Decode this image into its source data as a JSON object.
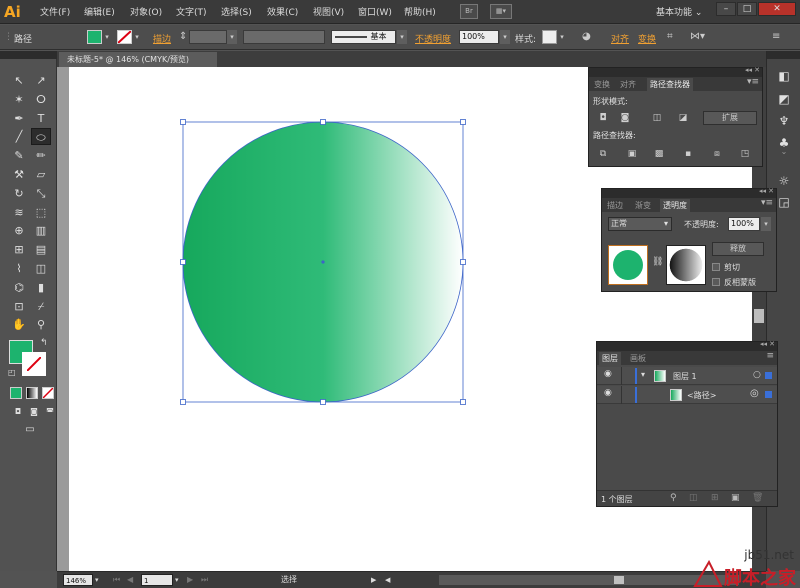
{
  "app": {
    "logo": "Ai"
  },
  "menubar": {
    "items": [
      "文件(F)",
      "编辑(E)",
      "对象(O)",
      "文字(T)",
      "选择(S)",
      "效果(C)",
      "视图(V)",
      "窗口(W)",
      "帮助(H)"
    ],
    "bridge_label": "Br",
    "workspace": "基本功能 ⌄",
    "win_minimize": "–",
    "win_restore": "□",
    "win_close": "✕"
  },
  "controlbar": {
    "object_type": "路径",
    "stroke_link": "描边",
    "stroke_style_label": "基本",
    "opacity_link": "不透明度",
    "opacity_value": "100%",
    "style_label": "样式:",
    "align_link": "对齐",
    "transform_link": "变换",
    "fill_color": "#1db36e"
  },
  "document": {
    "tab_title": "未标题-5* @ 146% (CMYK/预览)"
  },
  "canvas": {
    "gradient_start": "#16a85c",
    "gradient_mid": "#2fbb78",
    "gradient_end": "#ffffff",
    "bbox_color": "#3c64c8"
  },
  "toolbar": {
    "fill_swatch": "#1db36e",
    "tools": [
      {
        "name": "selection-tool",
        "glyph": "↖"
      },
      {
        "name": "direct-selection-tool",
        "glyph": "↗"
      },
      {
        "name": "magic-wand-tool",
        "glyph": "✶"
      },
      {
        "name": "lasso-tool",
        "glyph": "ⵔ"
      },
      {
        "name": "pen-tool",
        "glyph": "✒"
      },
      {
        "name": "type-tool",
        "glyph": "T"
      },
      {
        "name": "line-tool",
        "glyph": "╱"
      },
      {
        "name": "ellipse-tool",
        "glyph": "⬭"
      },
      {
        "name": "paintbrush-tool",
        "glyph": "✎"
      },
      {
        "name": "pencil-tool",
        "glyph": "✏"
      },
      {
        "name": "blob-brush-tool",
        "glyph": "⚒"
      },
      {
        "name": "eraser-tool",
        "glyph": "▱"
      },
      {
        "name": "rotate-tool",
        "glyph": "↻"
      },
      {
        "name": "scale-tool",
        "glyph": "⤡"
      },
      {
        "name": "warp-tool",
        "glyph": "≋"
      },
      {
        "name": "free-transform-tool",
        "glyph": "⬚"
      },
      {
        "name": "shape-builder-tool",
        "glyph": "⊕"
      },
      {
        "name": "perspective-grid-tool",
        "glyph": "▥"
      },
      {
        "name": "mesh-tool",
        "glyph": "⊞"
      },
      {
        "name": "gradient-tool",
        "glyph": "▤"
      },
      {
        "name": "eyedropper-tool",
        "glyph": "⌇"
      },
      {
        "name": "blend-tool",
        "glyph": "◫"
      },
      {
        "name": "symbol-sprayer-tool",
        "glyph": "⌬"
      },
      {
        "name": "column-graph-tool",
        "glyph": "▮"
      },
      {
        "name": "artboard-tool",
        "glyph": "⊡"
      },
      {
        "name": "slice-tool",
        "glyph": "⌿"
      },
      {
        "name": "hand-tool",
        "glyph": "✋"
      },
      {
        "name": "zoom-tool",
        "glyph": "⚲"
      }
    ]
  },
  "panel_pathfinder": {
    "tabs": [
      "变换",
      "对齐",
      "路径查找器"
    ],
    "shape_modes_label": "形状模式:",
    "expand_label": "扩展",
    "pathfinders_label": "路径查找器:"
  },
  "panel_transparency": {
    "tabs": [
      "描边",
      "渐变",
      "透明度"
    ],
    "blend_mode": "正常",
    "opacity_label": "不透明度:",
    "opacity_value": "100%",
    "release_label": "释放",
    "clip_label": "剪切",
    "invert_mask_label": "反相蒙版",
    "thumb_color": "#1db36e"
  },
  "panel_layers": {
    "tabs": [
      "图层",
      "画板"
    ],
    "layer_name": "图层 1",
    "path_name": "<路径>",
    "count_label": "1 个图层",
    "layer_color": "#3a6fd8"
  },
  "statusbar": {
    "zoom": "146%",
    "artboard": "1",
    "tool_label": "选择"
  },
  "watermark": {
    "url": "jb51.net",
    "text": "脚本之家"
  }
}
